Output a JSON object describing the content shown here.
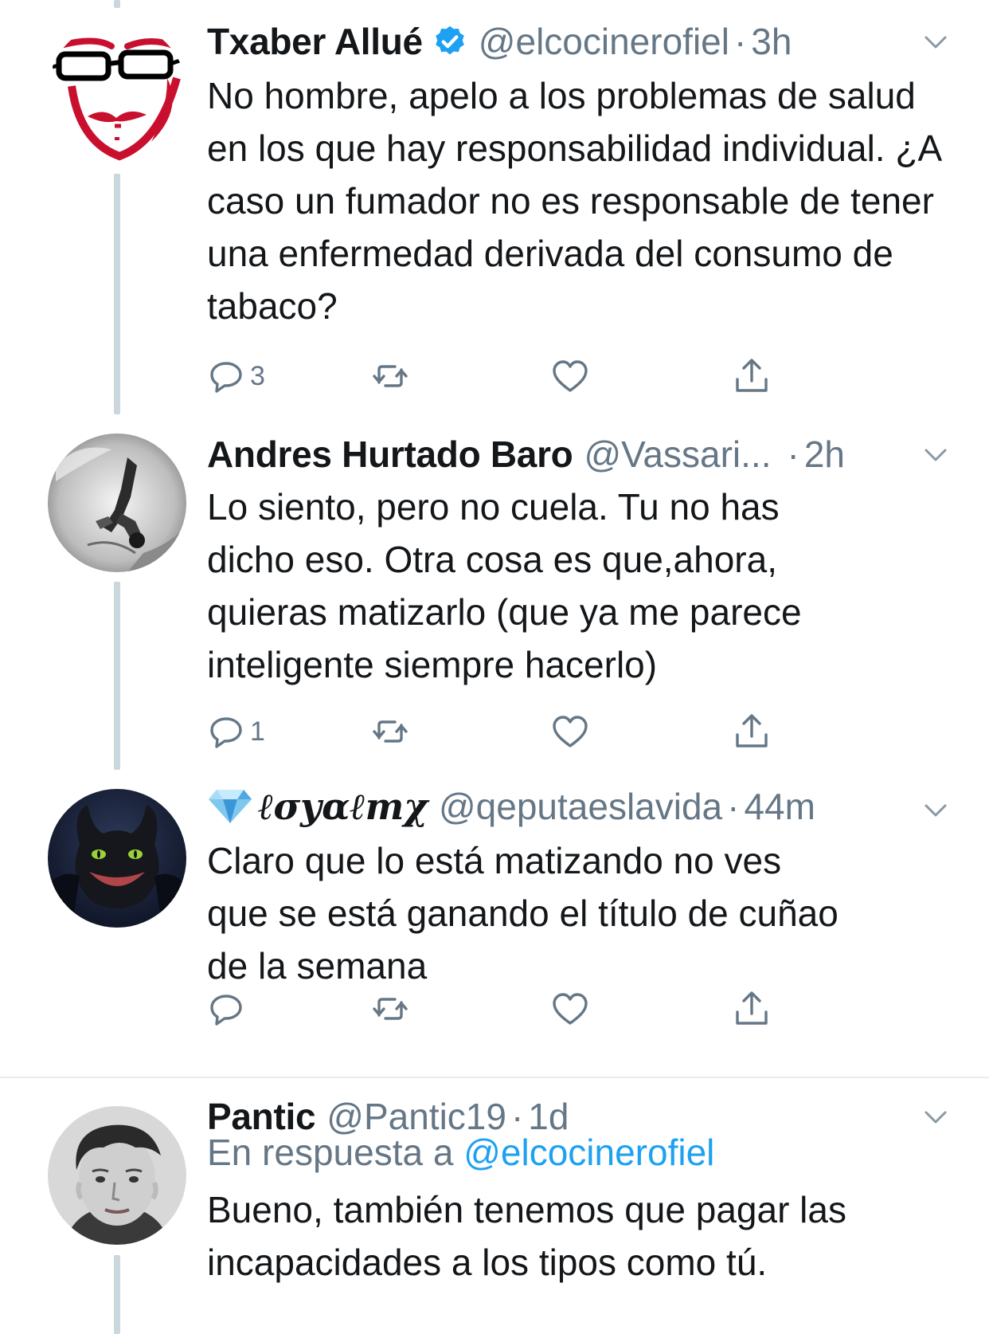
{
  "tweets": [
    {
      "name": "Txaber Allué",
      "handle": "@elcocinerofiel",
      "dot": "·",
      "time": "3h",
      "verified": true,
      "text": "No hombre, apelo a los problemas de salud en los que hay responsabilidad individual. ¿A caso un fumador no es responsable de tener una enfermedad derivada del consumo de tabaco?",
      "reply_count": "3"
    },
    {
      "name": "Andres Hurtado Baro",
      "handle": "@Vassari...",
      "dot": "·",
      "time": "2h",
      "text": "Lo siento, pero no cuela. Tu no has dicho eso. Otra cosa es que,ahora, quieras matizarlo (que ya me parece inteligente siempre  hacerlo)",
      "reply_count": "1"
    },
    {
      "name": "ℓσуαℓтχ",
      "handle": "@qeputaeslavida",
      "dot": "·",
      "time": "44m",
      "name_prefix_icon": "diamond-emoji",
      "text": "Claro que lo está matizando no ves que se está ganando el título de cuñao de la semana",
      "reply_count": ""
    },
    {
      "name": "Pantic",
      "handle": "@Pantic19",
      "dot": "·",
      "time": "1d",
      "reply_to_prefix": "En respuesta a ",
      "reply_to_handle": "@elcocinerofiel",
      "text": "Bueno, también tenemos que pagar las incapacidades a los tipos como tú."
    }
  ],
  "icons": {
    "reply": "reply-icon",
    "retweet": "retweet-icon",
    "like": "heart-icon",
    "share": "share-icon",
    "menu": "chevron-down-icon",
    "verified": "verified-badge-icon"
  },
  "colors": {
    "text": "#14171a",
    "secondary": "#657786",
    "link": "#1da1f2",
    "thread_line": "#ccd6dd",
    "divider": "#e6ecf0"
  }
}
